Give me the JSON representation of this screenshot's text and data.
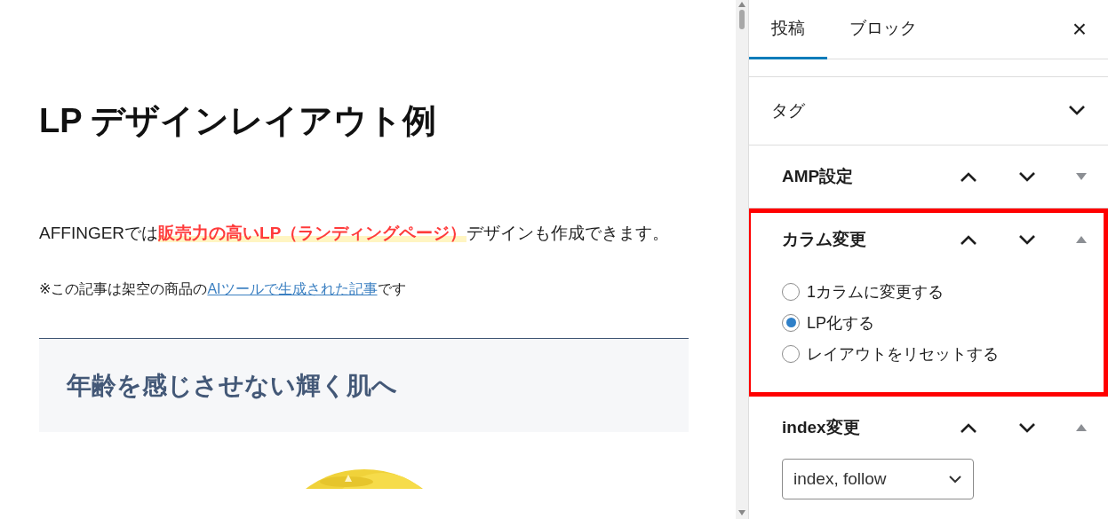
{
  "editor": {
    "title": "LP デザインレイアウト例",
    "paragraph": "AFFINGERでは**販売力の高いLP（ランディングページ）**デザインも作成できます。",
    "note": {
      "before": "※この記事は架空の商品の",
      "link": "AIツールで生成された記事",
      "after": "です"
    },
    "section_heading": "年齢を感じさせない輝く肌へ"
  },
  "sidebar": {
    "tabs": [
      {
        "label": "投稿",
        "selected": true
      },
      {
        "label": "ブロック",
        "selected": false
      }
    ],
    "close": "×",
    "panels": [
      {
        "kind": "plain",
        "title": "タグ",
        "expanded": false
      },
      {
        "kind": "meta-box",
        "title": "AMP設定",
        "expanded": false,
        "highlighted": false
      },
      {
        "kind": "meta-box",
        "title": "カラム変更",
        "expanded": true,
        "highlighted": true,
        "options": [
          {
            "label": "1カラムに変更する",
            "selected": false
          },
          {
            "label": "LP化する",
            "selected": true
          },
          {
            "label": "レイアウトをリセットする",
            "selected": false
          }
        ]
      },
      {
        "kind": "meta-box",
        "title": "index変更",
        "expanded": true,
        "highlighted": false,
        "select": {
          "value": "index, follow"
        }
      }
    ]
  }
}
